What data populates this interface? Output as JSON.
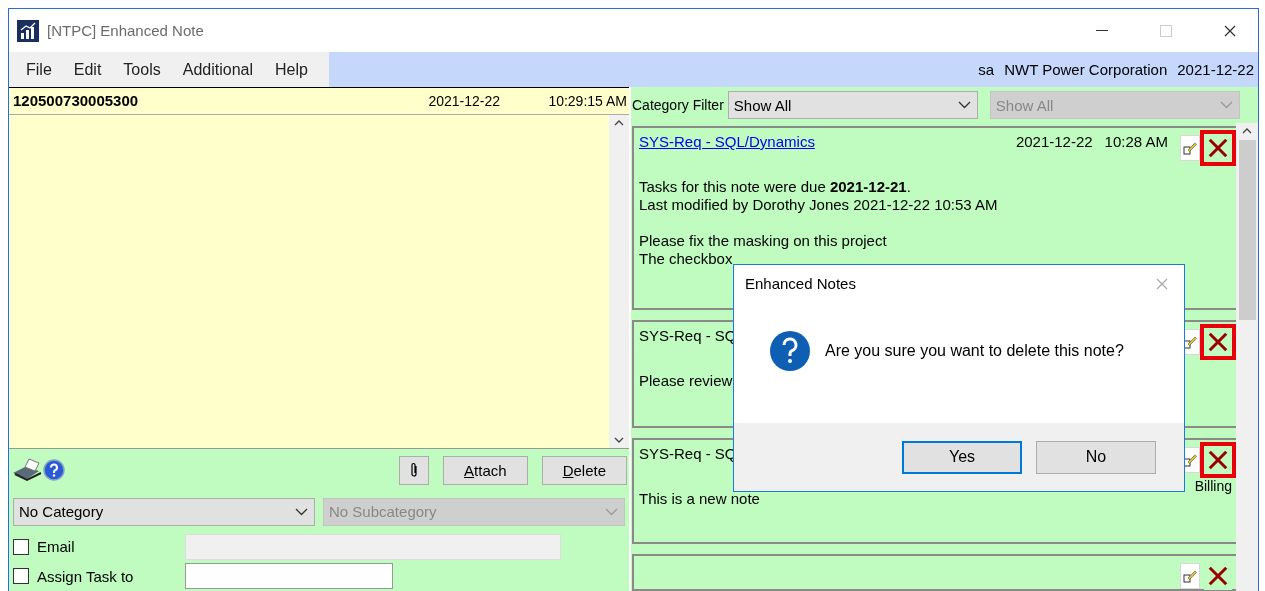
{
  "window": {
    "title": "[NTPC] Enhanced Note"
  },
  "menu": [
    "File",
    "Edit",
    "Tools",
    "Additional",
    "Help"
  ],
  "session": {
    "user": "sa",
    "company": "NWT Power Corporation",
    "date": "2021-12-22"
  },
  "note_header": {
    "number": "120500730005300",
    "date": "2021-12-22",
    "time": "10:29:15 AM"
  },
  "editor": {
    "buttons": [
      {
        "kind": "icon"
      },
      {
        "kind": "attach",
        "label": "Attach"
      },
      {
        "kind": "delete",
        "label": "Delete"
      }
    ],
    "category": {
      "value": "No Category",
      "disabled": false
    },
    "subcategory": {
      "value": "No Subcategory",
      "disabled": true
    },
    "options": [
      {
        "label": "Email",
        "checked": false,
        "kind": "text"
      },
      {
        "label": "Assign Task to",
        "checked": false,
        "kind": "select"
      }
    ]
  },
  "category_filter": {
    "label": "Category Filter",
    "value": "Show All",
    "disabled": false,
    "sub_value": "Show All",
    "sub_disabled": true
  },
  "notes": [
    {
      "title": "SYS-Req - SQL/Dynamics",
      "link": true,
      "date": "2021-12-22",
      "time": "10:28 AM",
      "highlighted": true,
      "paragraphs": [
        [
          "Tasks for this note were due **2021-12-21**.",
          "Last modified by Dorothy Jones 2021-12-22 10:53 AM"
        ],
        [
          "Please fix the masking on this project",
          "The checkbox"
        ]
      ]
    },
    {
      "title": "SYS-Req - SQ",
      "link": false,
      "highlighted": true,
      "paragraphs": [
        [
          "Please review"
        ]
      ]
    },
    {
      "title": "SYS-Req - SQ",
      "link": false,
      "highlighted": true,
      "category": "Billing",
      "paragraphs": [
        [
          "This is a new note"
        ]
      ]
    },
    {
      "highlighted": false
    }
  ],
  "dialog": {
    "title": "Enhanced Notes",
    "message": "Are you sure you want to delete this note?",
    "buttons": [
      {
        "label": "Yes",
        "default": true
      },
      {
        "label": "No",
        "default": false
      }
    ]
  }
}
